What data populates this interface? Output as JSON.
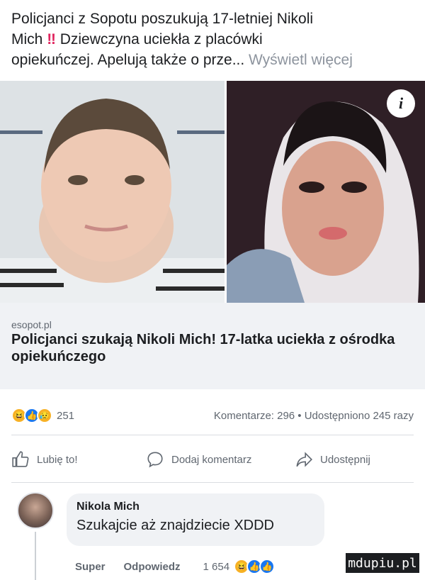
{
  "post": {
    "text_line1": "Policjanci z Sopotu poszukują 17-letniej Nikoli",
    "text_line2_name": "Mich",
    "text_line2_bang": "‼",
    "text_line2_rest": " Dziewczyna uciekła z placówki",
    "text_line3": "opiekuńczej. Apelują także o prze...",
    "see_more": " Wyświetl więcej"
  },
  "link": {
    "domain": "esopot.pl",
    "title": "Policjanci szukają Nikoli Mich! 17-latka uciekła z ośrodka opiekuńczego",
    "info_icon": "i"
  },
  "stats": {
    "reactions_count": "251",
    "comments_shares": "Komentarze: 296 • Udostępniono 245 razy",
    "reaction_icons": [
      "haha-icon",
      "like-icon",
      "sad-icon"
    ]
  },
  "actions": {
    "like": "Lubię to!",
    "comment": "Dodaj komentarz",
    "share": "Udostępnij"
  },
  "comment": {
    "author": "Nikola Mich",
    "text": "Szukajcie aż znajdziecie XDDD",
    "reply_super": "Super",
    "reply_label": "Odpowiedz",
    "reaction_count": "1 654"
  },
  "watermark": "mdupiu.pl",
  "colors": {
    "text": "#1c1e21",
    "secondary": "#606770",
    "like_blue": "#1877f2",
    "haha_yellow": "#f7b125",
    "bang_red": "#e0245e"
  }
}
